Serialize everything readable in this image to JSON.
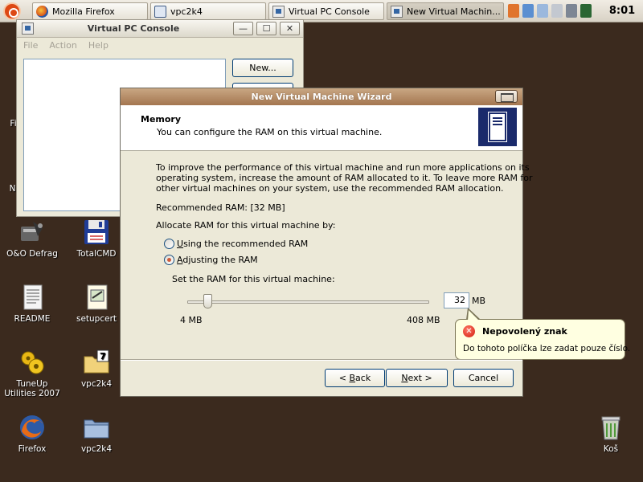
{
  "taskbar": {
    "tasks": [
      {
        "label": "Mozilla Firefox",
        "icon": "firefox-icon"
      },
      {
        "label": "vpc2k4",
        "icon": "folder-icon"
      },
      {
        "label": "Virtual PC Console",
        "icon": "virtual-pc-icon"
      },
      {
        "label": "New Virtual Machin...",
        "icon": "virtual-pc-icon"
      }
    ],
    "clock": "8:01"
  },
  "desktop_icons": [
    {
      "label": "O&O Defrag",
      "icon": "defrag-icon"
    },
    {
      "label": "TotalCMD",
      "icon": "floppy-icon"
    },
    {
      "label": "README",
      "icon": "text-document-icon"
    },
    {
      "label": "setupcert",
      "icon": "certificate-icon"
    },
    {
      "label": "TuneUp Utilities 2007",
      "icon": "tuneup-icon"
    },
    {
      "label": "vpc2k4",
      "icon": "archive-folder-icon"
    },
    {
      "label": "Firefox",
      "icon": "firefox-icon"
    },
    {
      "label": "vpc2k4",
      "icon": "folder-icon"
    },
    {
      "label": "Koš",
      "icon": "trash-icon"
    }
  ],
  "desktop_partial": {
    "left_1": "File",
    "left_2": "Ne"
  },
  "vpc_console": {
    "title": "Virtual PC Console",
    "menu": [
      "File",
      "Action",
      "Help"
    ],
    "new_button": "New..."
  },
  "wizard": {
    "title": "New Virtual Machine Wizard",
    "header_title": "Memory",
    "header_subtitle": "You can configure the RAM on this virtual machine.",
    "intro_lines": [
      "To improve the performance of this virtual machine and run more applications on its",
      "operating system, increase the amount of RAM allocated to it. To leave more RAM for",
      "other virtual machines on your system, use the recommended RAM allocation."
    ],
    "recommended": "Recommended RAM: [32 MB]",
    "allocate_label": "Allocate RAM for this virtual machine by:",
    "option_recommended": "Using the recommended RAM",
    "option_adjusting": "Adjusting the RAM",
    "selected_option": "Adjusting the RAM",
    "set_label": "Set the RAM for this virtual machine:",
    "slider_min": "4 MB",
    "slider_max": "408 MB",
    "slider_value_mb": 32,
    "ram_value": "32",
    "ram_unit": "MB",
    "buttons": {
      "back": "< Back",
      "next": "Next >",
      "cancel": "Cancel"
    }
  },
  "tooltip": {
    "title": "Nepovolený znak",
    "message": "Do tohoto políčka lze zadat pouze číslo."
  }
}
